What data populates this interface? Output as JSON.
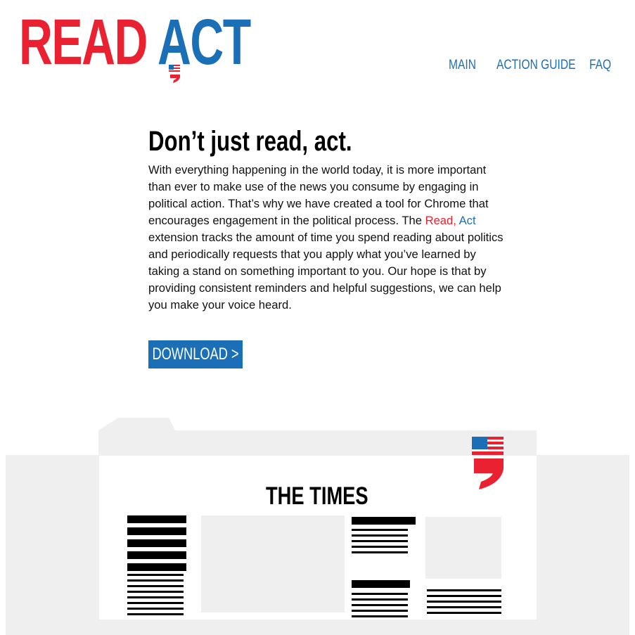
{
  "brand": {
    "word_read": "READ",
    "word_act": "ACT",
    "colors": {
      "red": "#ea2131",
      "blue": "#1a6fb7",
      "gray": "#efefef"
    }
  },
  "nav": {
    "items": [
      {
        "label": "MAIN"
      },
      {
        "label": "ACTION GUIDE"
      },
      {
        "label": "FAQ"
      }
    ]
  },
  "intro": {
    "headline": "Don’t just read, act.",
    "body_before": "With everything happening in the world today, it is more important than ever to make use of the news you consume by engaging in political action. That’s why we have created a tool for Chrome that encourages engagement in the political process. The ",
    "highlight_read": "Read,",
    "highlight_act": "Act",
    "body_after": " extension tracks the amount of time you spend reading about politics and periodically requests that you apply what you’ve learned by taking a stand on something important to you. Our hope is that by providing consistent reminders and helpful suggestions, we can help you make your voice heard.",
    "download_label": "DOWNLOAD >"
  },
  "illustration": {
    "newspaper_title": "THE TIMES",
    "icons": [
      "flag-comma-logo-icon"
    ]
  }
}
